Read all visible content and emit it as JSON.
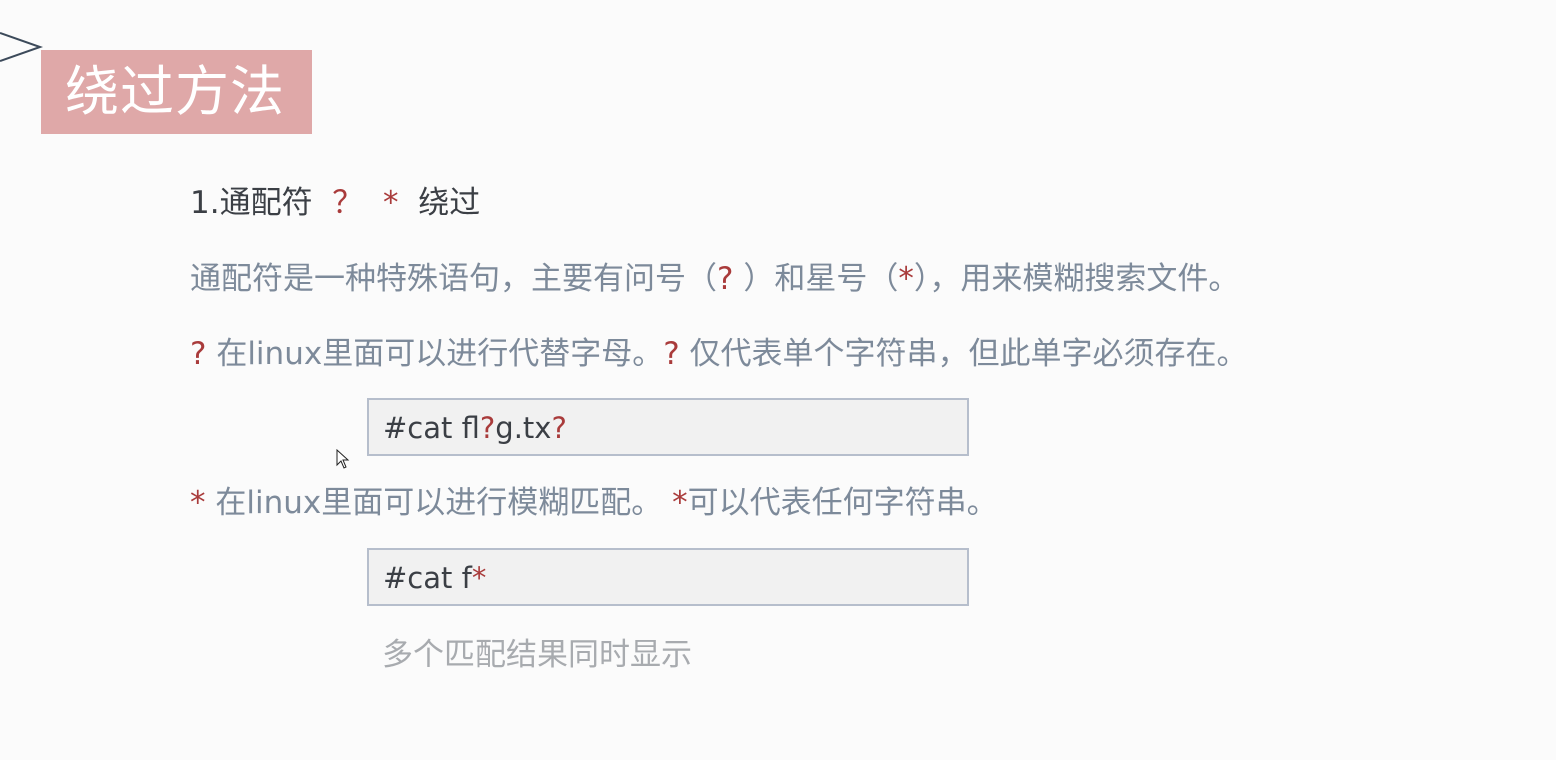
{
  "title": "绕过方法",
  "section": {
    "number_label": "1.通配符",
    "symbol_q": "？",
    "symbol_star": "*",
    "suffix": "绕过"
  },
  "paragraphs": {
    "intro": {
      "part1": "通配符是一种特殊语句，主要有问号（",
      "q": "?",
      "part2": " ）和星号（",
      "star": "*",
      "part3": "），用来模糊搜索文件。"
    },
    "question": {
      "q1": "?",
      "part1": " 在linux里面可以进行代替字母。",
      "q2": "?",
      "part2": " 仅代表单个字符串，但此单字必须存在。"
    },
    "star": {
      "s1": "*",
      "part1": " 在linux里面可以进行模糊匹配。 ",
      "s2": "*",
      "part2": "可以代表任何字符串。"
    }
  },
  "code_examples": {
    "example1": {
      "a": "#cat fl",
      "b": "?",
      "c": "g.tx",
      "d": "?"
    },
    "example2": {
      "a": "#cat f",
      "b": "*"
    }
  },
  "note": "多个匹配结果同时显示",
  "colors": {
    "title_bg": "#dfa8a8",
    "accent_red": "#a93b3b",
    "body_text": "#7d8a9a",
    "code_bg": "#f1f1f1",
    "code_border": "#b6becc"
  },
  "icons": {
    "corner": "chevron-right-outline-icon",
    "cursor": "mouse-pointer-icon"
  }
}
